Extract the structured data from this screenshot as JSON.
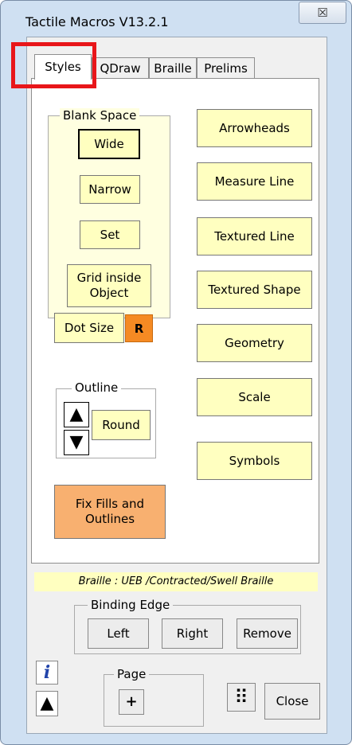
{
  "window": {
    "title": "Tactile Macros V13.2.1",
    "close_glyph": "☒"
  },
  "tabs": [
    {
      "label": "Styles",
      "active": true
    },
    {
      "label": "QDraw"
    },
    {
      "label": "Braille"
    },
    {
      "label": "Prelims"
    }
  ],
  "blank_space": {
    "legend": "Blank Space",
    "wide": "Wide",
    "narrow": "Narrow",
    "set": "Set",
    "grid_inside_object": "Grid inside Object"
  },
  "dot_size": {
    "label": "Dot Size",
    "r_label": "R"
  },
  "outline": {
    "legend": "Outline",
    "up": "▲",
    "down": "▼",
    "round": "Round"
  },
  "fix_fills": "Fix Fills and Outlines",
  "right_buttons": {
    "arrowheads": "Arrowheads",
    "measure_line": "Measure Line",
    "textured_line": "Textured Line",
    "textured_shape": "Textured Shape",
    "geometry": "Geometry",
    "scale": "Scale",
    "symbols": "Symbols"
  },
  "braille_info": "Braille : UEB /Contracted/Swell Braille",
  "binding_edge": {
    "legend": "Binding Edge",
    "left": "Left",
    "right": "Right",
    "remove": "Remove"
  },
  "page": {
    "legend": "Page",
    "plus": "+"
  },
  "footer": {
    "info": "i",
    "up": "▲",
    "dots": "⠿",
    "close": "Close"
  },
  "colors": {
    "button_yellow": "#ffffc0",
    "accent_orange": "#f8b070",
    "r_orange": "#f58a23",
    "highlight_red": "#e8161a"
  }
}
